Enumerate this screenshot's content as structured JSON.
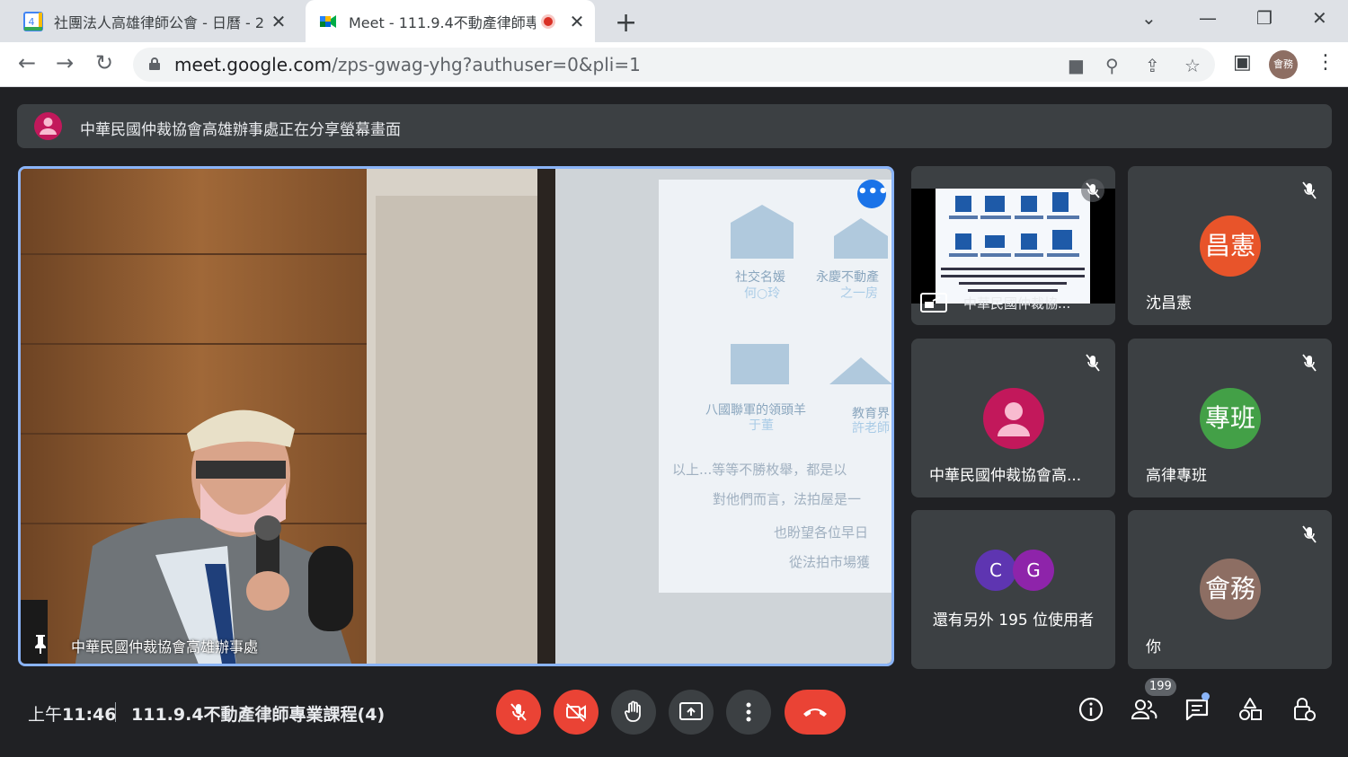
{
  "browser": {
    "tabs": [
      {
        "title": "社團法人高雄律師公會 - 日曆 - 2",
        "favicon": "google-calendar-icon",
        "favicon_text": "4"
      },
      {
        "title": "Meet - 111.9.4不動產律師專",
        "favicon": "google-meet-icon"
      }
    ],
    "url_host": "meet.google.com",
    "url_rest": "/zps-gwag-yhg?authuser=0&pli=1",
    "profile_label": "會務"
  },
  "banner": {
    "text": "中華民國仲裁協會高雄辦事處正在分享螢幕畫面"
  },
  "main_tile": {
    "name": "中華民國仲裁協會高雄辦事處",
    "more_label": "•••",
    "slide": {
      "items": [
        "社交名媛",
        "何○玲",
        "永慶不動產",
        "之一房",
        "八國聯軍的領頭羊",
        "于董",
        "教育界",
        "許老師"
      ],
      "lines": [
        "以上...等等不勝枚舉，都是以",
        "對他們而言，法拍屋是一",
        "也盼望各位早日",
        "從法拍市場獲"
      ]
    }
  },
  "tiles": [
    {
      "name": "中華民國仲裁協...",
      "type": "presentation"
    },
    {
      "name": "沈昌憲",
      "avatar_text": "昌憲",
      "avatar_color": "#e8542a"
    },
    {
      "name": "中華民國仲裁協會高...",
      "avatar_color": "#c2185b",
      "type": "person"
    },
    {
      "name": "高律專班",
      "avatar_text": "專班",
      "avatar_color": "#43a047"
    },
    {
      "name": "還有另外 195 位使用者",
      "c1": "C",
      "c2": "G",
      "c1_color": "#5e35b1",
      "c2_color": "#8e24aa"
    },
    {
      "name": "你",
      "avatar_text": "會務",
      "avatar_color": "#8d6e63"
    }
  ],
  "bottom": {
    "time_prefix": "上午",
    "time": "11:46",
    "meeting_title": "111.9.4不動產律師專業課程(4)",
    "people_count": "199"
  }
}
